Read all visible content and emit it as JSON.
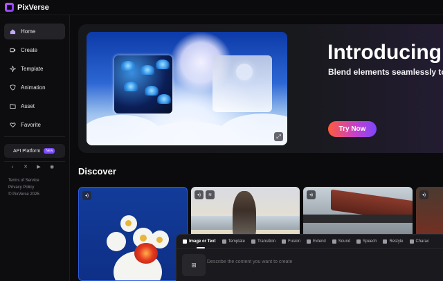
{
  "app": {
    "name": "PixVerse"
  },
  "sidebar": {
    "items": [
      {
        "label": "Home",
        "icon": "home-icon",
        "active": true
      },
      {
        "label": "Create",
        "icon": "video-icon"
      },
      {
        "label": "Template",
        "icon": "sparkle-icon"
      },
      {
        "label": "Animation",
        "icon": "animation-icon"
      },
      {
        "label": "Asset",
        "icon": "folder-icon"
      },
      {
        "label": "Favorite",
        "icon": "heart-icon"
      }
    ],
    "api_platform": {
      "label": "API Platform",
      "badge": "New"
    },
    "socials": [
      "tiktok-icon",
      "x-icon",
      "youtube-icon",
      "discord-icon"
    ],
    "footer": {
      "terms": "Terms of Service",
      "privacy": "Privacy Policy",
      "copyright": "© PixVerse 2025"
    }
  },
  "hero": {
    "title": "Introducing",
    "subtitle": "Blend elements seamlessly to",
    "cta": "Try Now"
  },
  "discover": {
    "title": "Discover"
  },
  "prompt": {
    "tabs": [
      "Image or Text",
      "Template",
      "Transition",
      "Fusion",
      "Extend",
      "Sound",
      "Speech",
      "Restyle",
      "Charac"
    ],
    "active_tab": "Image or Text",
    "placeholder": "Describe the content you want to create"
  },
  "colors": {
    "accent": "#7a4bff",
    "cta_start": "#ff5b3b",
    "cta_end": "#7d45ff",
    "background": "#0b0b0d"
  }
}
